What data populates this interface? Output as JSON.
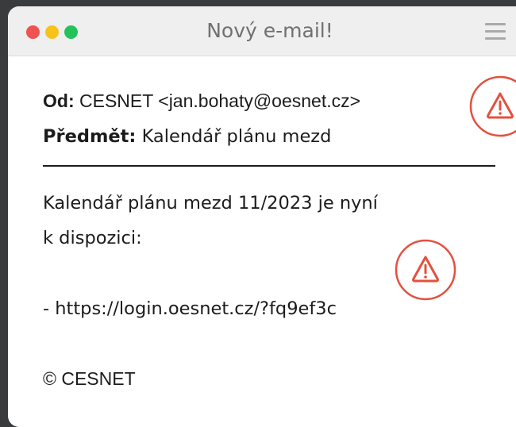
{
  "window": {
    "title": "Nový e-mail!",
    "dots": {
      "red": "#f05252",
      "yellow": "#f7c21a",
      "green": "#25c25a"
    }
  },
  "header": {
    "from_label": "Od:",
    "from_value": "CESNET <jan.bohaty@oesnet.cz>",
    "subject_label": "Předmět:",
    "subject_value": "Kalendář plánu mezd"
  },
  "body": {
    "line1": "Kalendář plánu mezd 11/2023 je nyní",
    "line2": "k dispozici:",
    "link": "- https://login.oesnet.cz/?fq9ef3c",
    "footer": "© CESNET"
  },
  "icons": {
    "menu": "hamburger-menu-icon",
    "warning": "warning-icon",
    "warning_color": "#e4513f"
  }
}
